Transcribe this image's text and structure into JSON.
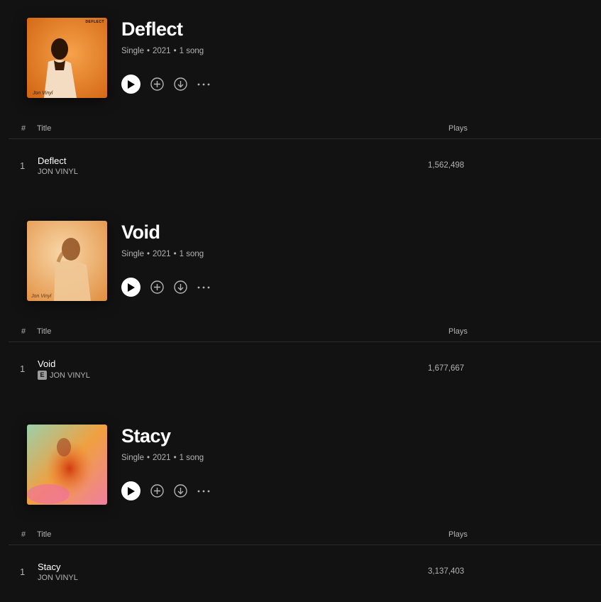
{
  "columns": {
    "hash": "#",
    "title": "Title",
    "plays": "Plays"
  },
  "releases": [
    {
      "title": "Deflect",
      "type": "Single",
      "year": "2021",
      "song_count": "1 song",
      "cover_tag": "DEFLECT",
      "cover_colors": [
        "#f08a2c",
        "#d66a14"
      ],
      "track": {
        "number": "1",
        "title": "Deflect",
        "artist": "JON VINYL",
        "explicit": false,
        "plays": "1,562,498"
      }
    },
    {
      "title": "Void",
      "type": "Single",
      "year": "2021",
      "song_count": "1 song",
      "cover_tag": "",
      "cover_colors": [
        "#f4c58e",
        "#e29a4e"
      ],
      "track": {
        "number": "1",
        "title": "Void",
        "artist": "JON VINYL",
        "explicit": true,
        "explicit_label": "E",
        "plays": "1,677,667"
      }
    },
    {
      "title": "Stacy",
      "type": "Single",
      "year": "2021",
      "song_count": "1 song",
      "cover_tag": "",
      "cover_colors": [
        "#8fc6a2",
        "#f07e2a"
      ],
      "track": {
        "number": "1",
        "title": "Stacy",
        "artist": "JON VINYL",
        "explicit": false,
        "plays": "3,137,403"
      }
    }
  ],
  "icons": {
    "play": "play-icon",
    "add": "add-circle-icon",
    "download": "download-icon",
    "more": "more-options-icon"
  }
}
